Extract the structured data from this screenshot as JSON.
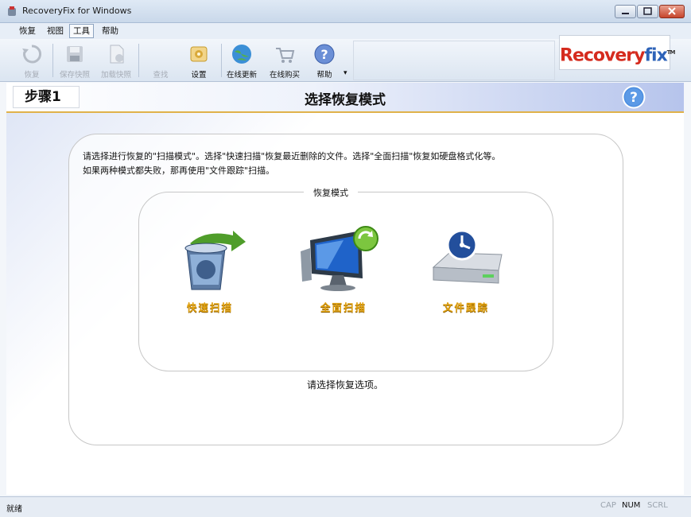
{
  "window": {
    "title": "RecoveryFix for Windows"
  },
  "menu": {
    "items": [
      "恢复",
      "视图",
      "工具",
      "帮助"
    ]
  },
  "toolbar": {
    "buttons": [
      {
        "label": "恢复",
        "icon": "recover-icon",
        "enabled": false
      },
      {
        "label": "保存快照",
        "icon": "save-snapshot-icon",
        "enabled": false
      },
      {
        "label": "加载快照",
        "icon": "load-snapshot-icon",
        "enabled": false
      },
      {
        "label": "查找",
        "icon": "find-icon",
        "enabled": false
      },
      {
        "label": "设置",
        "icon": "settings-icon",
        "enabled": true
      },
      {
        "label": "在线更新",
        "icon": "online-update-icon",
        "enabled": true
      },
      {
        "label": "在线购买",
        "icon": "online-buy-icon",
        "enabled": true
      },
      {
        "label": "帮助",
        "icon": "help-icon",
        "enabled": true
      }
    ],
    "logo": {
      "text_main": "Recovery",
      "text_accent": "fix",
      "tm": "TM"
    }
  },
  "step": {
    "label": "步骤1",
    "title": "选择恢复模式"
  },
  "main": {
    "description_line1": "请选择进行恢复的\"扫描模式\"。选择\"快速扫描\"恢复最近删除的文件。选择\"全面扫描\"恢复如硬盘格式化等。",
    "description_line2": "如果两种模式都失败，那再使用\"文件跟踪\"扫描。",
    "group_title": "恢复模式",
    "modes": [
      {
        "label": "快速扫描",
        "icon": "recycle-bin-icon"
      },
      {
        "label": "全面扫描",
        "icon": "computer-refresh-icon"
      },
      {
        "label": "文件跟踪",
        "icon": "drive-trace-icon"
      }
    ],
    "prompt": "请选择恢复选项。"
  },
  "statusbar": {
    "text": "就绪",
    "indicators": [
      "CAP",
      "NUM",
      "SCRL"
    ]
  },
  "colors": {
    "accent": "#e2a20f",
    "step_underline": "#e0b24a",
    "logo_red": "#d52b1e",
    "logo_blue": "#2e63b8"
  }
}
